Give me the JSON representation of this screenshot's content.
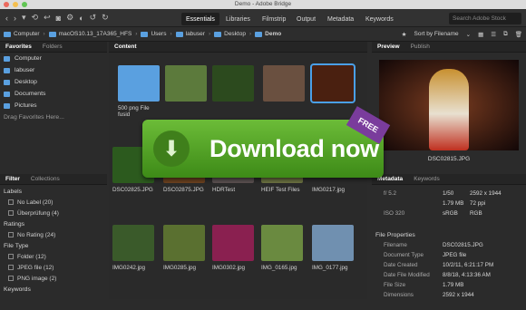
{
  "window": {
    "title": "Demo - Adobe Bridge"
  },
  "workspaces": [
    "Essentials",
    "Libraries",
    "Filmstrip",
    "Output",
    "Metadata",
    "Keywords"
  ],
  "search": {
    "placeholder": "Search Adobe Stock"
  },
  "path": [
    "Computer",
    "macOS10.13_17A365_HFS",
    "Users",
    "labuser",
    "Desktop",
    "Demo"
  ],
  "sort": {
    "label": "Sort by Filename"
  },
  "left_tabs": [
    "Favorites",
    "Folders"
  ],
  "favorites": [
    "Computer",
    "labuser",
    "Desktop",
    "Documents",
    "Pictures"
  ],
  "favorites_hint": "Drag Favorites Here...",
  "content_tab": "Content",
  "thumbs": [
    {
      "caption": "500 png File fusid",
      "color": "#5aa0e0"
    },
    {
      "caption": "",
      "color": "#5c7a3c"
    },
    {
      "caption": "",
      "color": "#2c4a1e"
    },
    {
      "caption": "",
      "color": "#6a5040"
    },
    {
      "caption": "",
      "color": "#4a2010"
    },
    {
      "caption": "DSC02825.JPG",
      "color": "#2c5a1e"
    },
    {
      "caption": "DSC02875.JPG",
      "color": "#6a4020"
    },
    {
      "caption": "HDRTest",
      "color": "#5a5050"
    },
    {
      "caption": "HEIF Test Files",
      "color": "#6a7040"
    },
    {
      "caption": "IMG0217.jpg",
      "color": "#2a2a2a"
    },
    {
      "caption": "IMG0242.jpg",
      "color": "#3a5a2a"
    },
    {
      "caption": "IMG0285.jpg",
      "color": "#5a7030"
    },
    {
      "caption": "IMG0302.jpg",
      "color": "#8a2050"
    },
    {
      "caption": "IMG_0165.jpg",
      "color": "#6a8a40"
    },
    {
      "caption": "IMG_0177.jpg",
      "color": "#7090b0"
    }
  ],
  "banner": {
    "text": "Download now",
    "badge": "FREE"
  },
  "right_tabs": [
    "Preview",
    "Publish"
  ],
  "preview_caption": "DSC02815.JPG",
  "meta_tabs": [
    "Metadata",
    "Keywords"
  ],
  "camera": {
    "aperture": "f/ 5.2",
    "shutter": "1/50",
    "size": "2592 x 1944",
    "filesize": "1.79 MB",
    "ppi": "72 ppi",
    "iso": "ISO 320",
    "space": "sRGB",
    "mode": "RGB"
  },
  "file_props_title": "File Properties",
  "file_props": [
    {
      "k": "Filename",
      "v": "DSC02815.JPG"
    },
    {
      "k": "Document Type",
      "v": "JPEG file"
    },
    {
      "k": "Date Created",
      "v": "10/2/11, 6:21:17 PM"
    },
    {
      "k": "Date File Modified",
      "v": "8/8/18, 4:13:36 AM"
    },
    {
      "k": "File Size",
      "v": "1.79 MB"
    },
    {
      "k": "Dimensions",
      "v": "2592 x 1944"
    }
  ],
  "filter_tabs": [
    "Filter",
    "Collections"
  ],
  "filter": {
    "labels_title": "Labels",
    "labels": [
      {
        "t": "No Label",
        "n": "(20)"
      },
      {
        "t": "Überprüfung",
        "n": "(4)"
      }
    ],
    "ratings_title": "Ratings",
    "ratings": [
      {
        "t": "No Rating",
        "n": "(24)"
      }
    ],
    "filetype_title": "File Type",
    "filetypes": [
      {
        "t": "Folder",
        "n": "(12)"
      },
      {
        "t": "JPEG file",
        "n": "(12)"
      },
      {
        "t": "PNG image",
        "n": "(2)"
      }
    ],
    "keywords_title": "Keywords"
  }
}
